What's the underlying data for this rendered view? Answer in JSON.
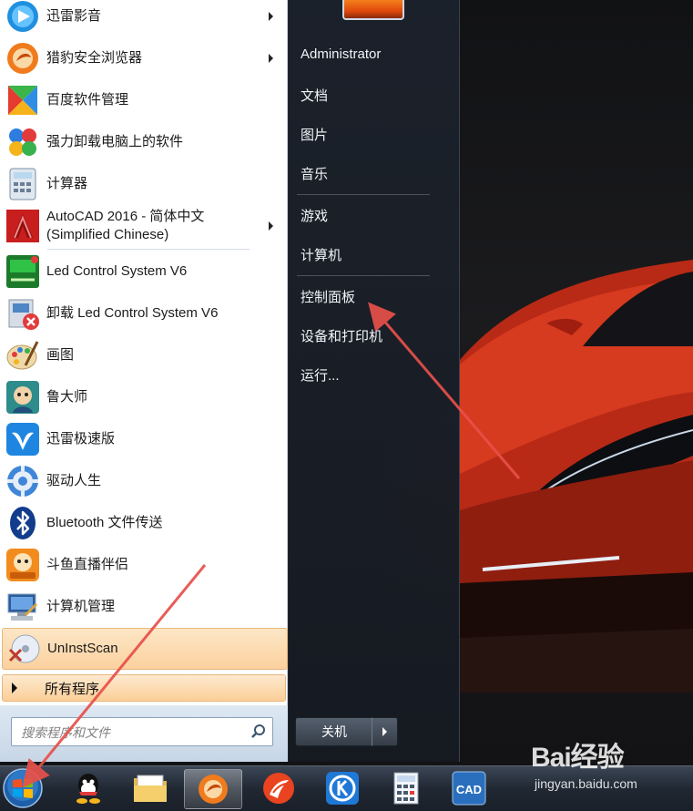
{
  "start_menu": {
    "programs": [
      {
        "label": "迅雷影音",
        "icon": "xunlei-player-icon",
        "has_submenu": true
      },
      {
        "label": "猎豹安全浏览器",
        "icon": "liebao-browser-icon",
        "has_submenu": true
      },
      {
        "label": "百度软件管理",
        "icon": "baidu-software-manager-icon",
        "has_submenu": false
      },
      {
        "label": "强力卸载电脑上的软件",
        "icon": "uninstall-tool-icon",
        "has_submenu": false
      },
      {
        "label": "计算器",
        "icon": "calculator-icon",
        "has_submenu": false
      },
      {
        "label": "AutoCAD 2016 - 简体中文",
        "label2": "(Simplified Chinese)",
        "icon": "autocad-icon",
        "has_submenu": true
      },
      {
        "label": "Led Control System V6",
        "icon": "led-control-icon",
        "has_submenu": false
      },
      {
        "label": "卸载 Led Control System V6",
        "icon": "uninstall-led-icon",
        "has_submenu": false
      },
      {
        "label": "画图",
        "icon": "paint-icon",
        "has_submenu": false
      },
      {
        "label": "鲁大师",
        "icon": "ludashi-icon",
        "has_submenu": false
      },
      {
        "label": "迅雷极速版",
        "icon": "xunlei-icon",
        "has_submenu": false
      },
      {
        "label": "驱动人生",
        "icon": "driver-life-icon",
        "has_submenu": false
      },
      {
        "label": "Bluetooth 文件传送",
        "icon": "bluetooth-icon",
        "has_submenu": false
      },
      {
        "label": "斗鱼直播伴侣",
        "icon": "douyu-icon",
        "has_submenu": false
      },
      {
        "label": "计算机管理",
        "icon": "computer-management-icon",
        "has_submenu": false
      },
      {
        "label": "UnInstScan",
        "icon": "uninstscan-icon",
        "has_submenu": false,
        "highlighted": true
      }
    ],
    "all_programs_label": "所有程序",
    "search_placeholder": "搜索程序和文件",
    "right_links": [
      "Administrator",
      "文档",
      "图片",
      "音乐",
      "游戏",
      "计算机",
      "控制面板",
      "设备和打印机",
      "运行..."
    ],
    "shutdown_label": "关机"
  },
  "taskbar": {
    "items": [
      "start-orb",
      "qq-icon",
      "file-explorer-icon",
      "liebao-browser-icon",
      "foxmail-icon",
      "kugou-icon",
      "calculator-app-icon",
      "cad-icon"
    ],
    "active_item": "liebao-browser-icon"
  },
  "watermark": {
    "brand": "Bai经验",
    "url": "jingyan.baidu.com"
  },
  "colors": {
    "highlight": "#fbd19e",
    "annotation_arrow": "#e8504a",
    "right_pane": "#1c222c"
  }
}
